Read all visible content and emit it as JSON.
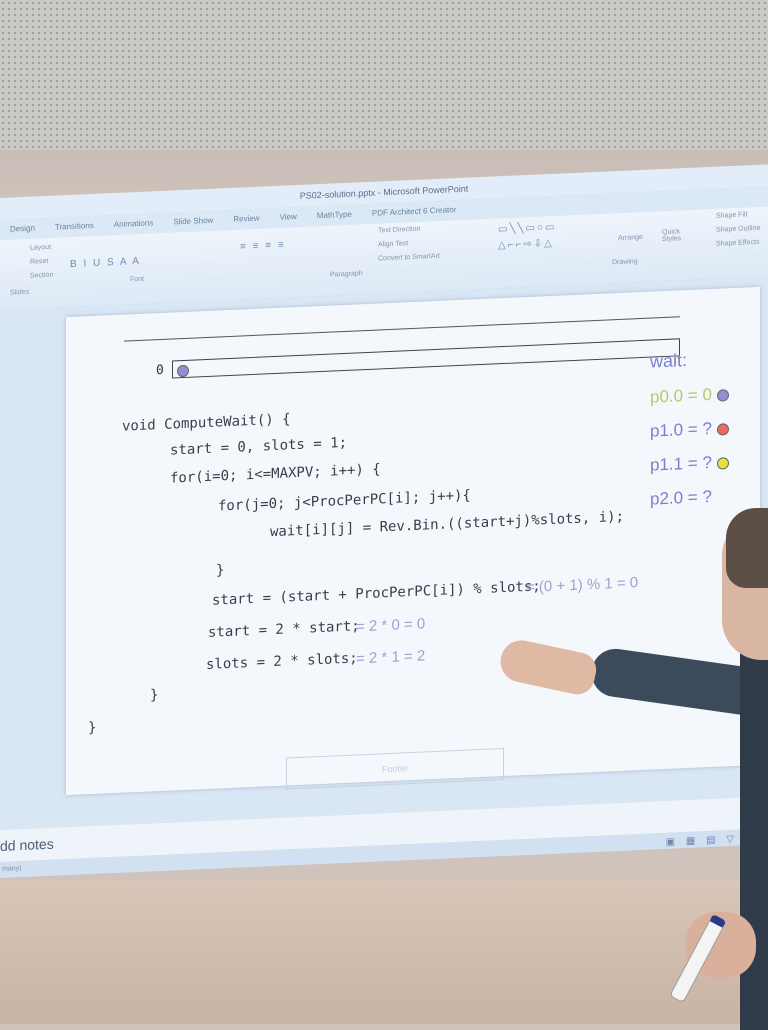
{
  "window": {
    "title": "PS02-solution.pptx - Microsoft PowerPoint"
  },
  "ribbon": {
    "tabs": [
      "Design",
      "Transitions",
      "Animations",
      "Slide Show",
      "Review",
      "View",
      "MathType",
      "PDF Architect 6 Creator"
    ],
    "slides_group": {
      "layout": "Layout",
      "reset": "Reset",
      "section": "Section",
      "label": "Slides"
    },
    "font_group_label": "Font",
    "paragraph_group_label": "Paragraph",
    "paragraph_tools": [
      "Text Direction",
      "Align Text",
      "Convert to SmartArt"
    ],
    "drawing_group_label": "Drawing",
    "arrange_label": "Arrange",
    "quick_styles_label": "Quick Styles",
    "shape_tools": [
      "Shape Fill",
      "Shape Outline",
      "Shape Effects"
    ]
  },
  "slide": {
    "zero_label": "0",
    "bar_dot_color": "#8f8fd8",
    "code_lines": [
      "void ComputeWait() {",
      "start = 0, slots = 1;",
      "for(i=0; i<=MAXPV; i++) {",
      "for(j=0; j<ProcPerPC[i]; j++){",
      "wait[i][j] = Rev.Bin.((start+j)%slots, i);",
      "}",
      "start = (start + ProcPerPC[i]) % slots;",
      "start = 2 * start;",
      "slots = 2 * slots;",
      "}",
      "}"
    ],
    "annotations": [
      "= (0 + 1) % 1 = 0",
      "= 2 * 0 = 0",
      "= 2 * 1 = 2"
    ],
    "legend": {
      "title": "wait:",
      "items": [
        {
          "text": "p0.0 = 0",
          "color": "#b8c96a",
          "dot": "#8f8fd8"
        },
        {
          "text": "p1.0 = ?",
          "color": "#7a7fd0",
          "dot": "#e86b5f"
        },
        {
          "text": "p1.1 = ?",
          "color": "#7a7fd0",
          "dot": "#e6e040"
        },
        {
          "text": "p2.0 = ?",
          "color": "#7a7fd0",
          "dot": ""
        }
      ]
    },
    "footer": "Footer"
  },
  "notes": {
    "placeholder": "dd notes"
  },
  "status": {
    "language": "many)"
  }
}
